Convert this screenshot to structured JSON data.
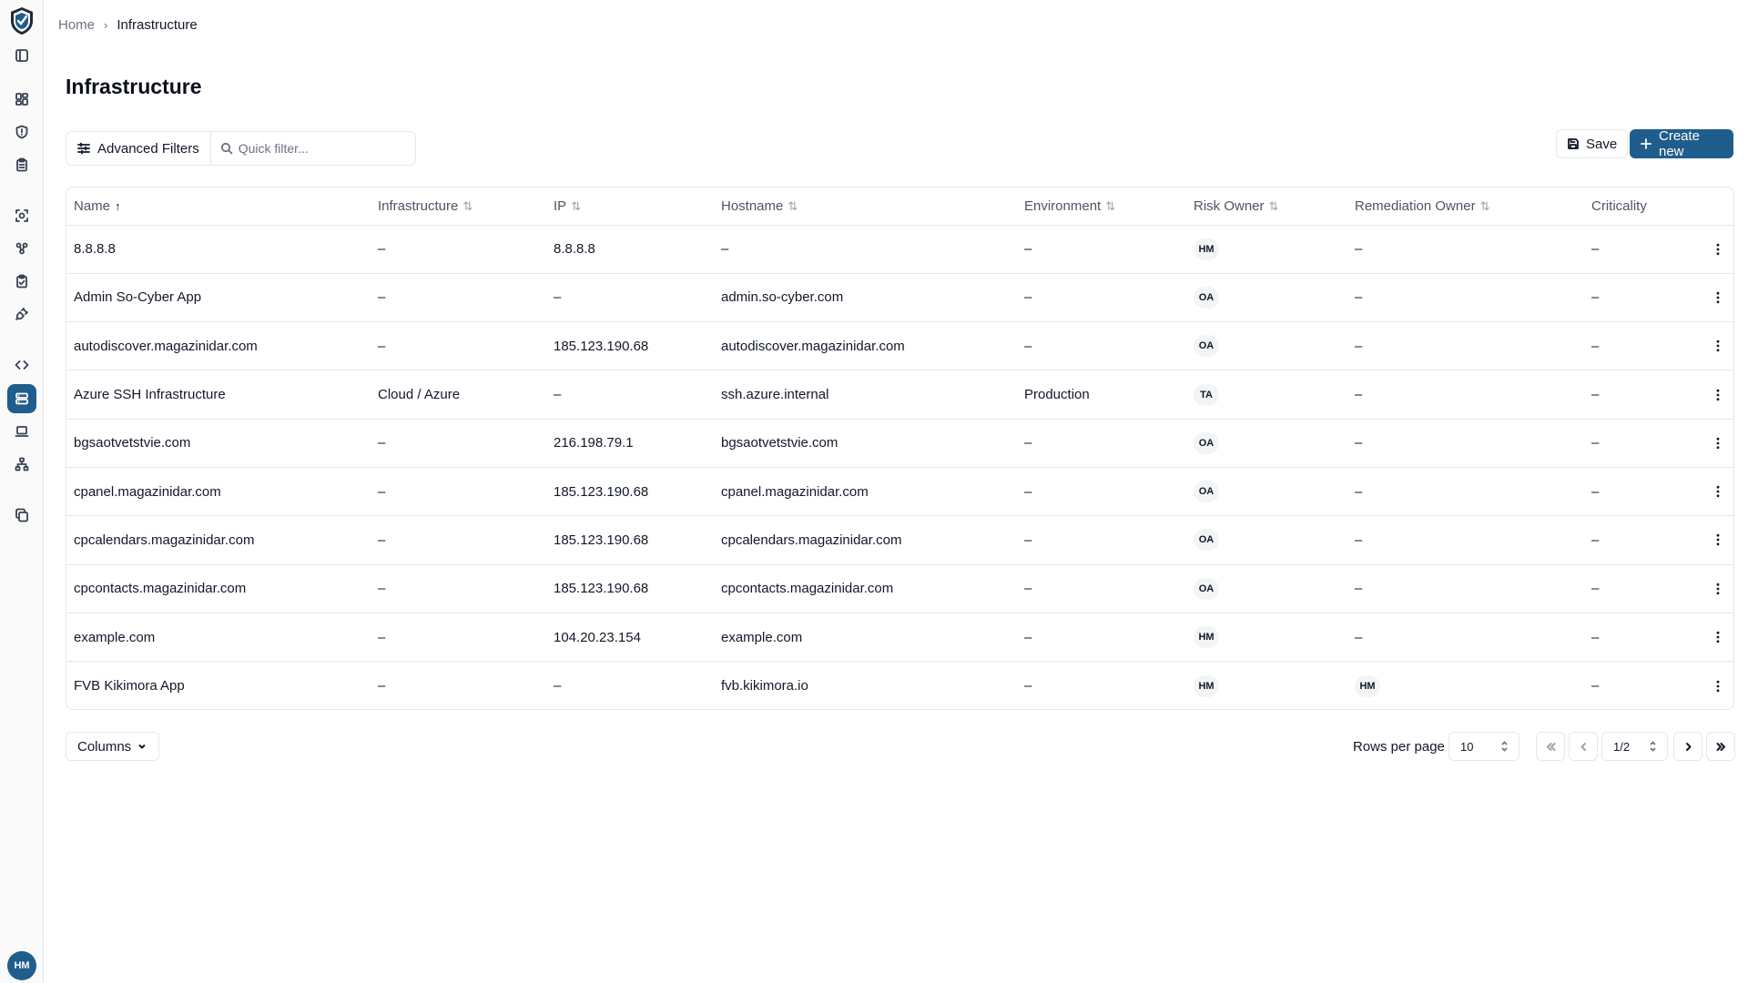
{
  "user": {
    "initials": "HM"
  },
  "colors": {
    "accent": "#1f5d8c",
    "border": "#e5e7eb",
    "muted": "#6b7280"
  },
  "breadcrumb": {
    "home": "Home",
    "current": "Infrastructure"
  },
  "page": {
    "title": "Infrastructure"
  },
  "toolbar": {
    "advanced_filters": "Advanced Filters",
    "quick_filter_placeholder": "Quick filter...",
    "save": "Save",
    "create_new": "Create new"
  },
  "table": {
    "headers": {
      "name": "Name",
      "infrastructure": "Infrastructure",
      "ip": "IP",
      "hostname": "Hostname",
      "environment": "Environment",
      "risk_owner": "Risk Owner",
      "remediation_owner": "Remediation Owner",
      "criticality": "Criticality"
    },
    "rows": [
      {
        "name": "8.8.8.8",
        "infrastructure": "–",
        "ip": "8.8.8.8",
        "hostname": "–",
        "environment": "–",
        "risk_owner": "HM",
        "remediation_owner": "–",
        "criticality": "–"
      },
      {
        "name": "Admin So-Cyber App",
        "infrastructure": "–",
        "ip": "–",
        "hostname": "admin.so-cyber.com",
        "environment": "–",
        "risk_owner": "OA",
        "remediation_owner": "–",
        "criticality": "–"
      },
      {
        "name": "autodiscover.magazinidar.com",
        "infrastructure": "–",
        "ip": "185.123.190.68",
        "hostname": "autodiscover.magazinidar.com",
        "environment": "–",
        "risk_owner": "OA",
        "remediation_owner": "–",
        "criticality": "–"
      },
      {
        "name": "Azure SSH Infrastructure",
        "infrastructure": "Cloud / Azure",
        "ip": "–",
        "hostname": "ssh.azure.internal",
        "environment": "Production",
        "risk_owner": "TA",
        "remediation_owner": "–",
        "criticality": "–"
      },
      {
        "name": "bgsaotvetstvie.com",
        "infrastructure": "–",
        "ip": "216.198.79.1",
        "hostname": "bgsaotvetstvie.com",
        "environment": "–",
        "risk_owner": "OA",
        "remediation_owner": "–",
        "criticality": "–"
      },
      {
        "name": "cpanel.magazinidar.com",
        "infrastructure": "–",
        "ip": "185.123.190.68",
        "hostname": "cpanel.magazinidar.com",
        "environment": "–",
        "risk_owner": "OA",
        "remediation_owner": "–",
        "criticality": "–"
      },
      {
        "name": "cpcalendars.magazinidar.com",
        "infrastructure": "–",
        "ip": "185.123.190.68",
        "hostname": "cpcalendars.magazinidar.com",
        "environment": "–",
        "risk_owner": "OA",
        "remediation_owner": "–",
        "criticality": "–"
      },
      {
        "name": "cpcontacts.magazinidar.com",
        "infrastructure": "–",
        "ip": "185.123.190.68",
        "hostname": "cpcontacts.magazinidar.com",
        "environment": "–",
        "risk_owner": "OA",
        "remediation_owner": "–",
        "criticality": "–"
      },
      {
        "name": "example.com",
        "infrastructure": "–",
        "ip": "104.20.23.154",
        "hostname": "example.com",
        "environment": "–",
        "risk_owner": "HM",
        "remediation_owner": "–",
        "criticality": "–"
      },
      {
        "name": "FVB Kikimora App",
        "infrastructure": "–",
        "ip": "–",
        "hostname": "fvb.kikimora.io",
        "environment": "–",
        "risk_owner": "HM",
        "remediation_owner": "HM",
        "criticality": "–"
      }
    ]
  },
  "footer": {
    "columns": "Columns",
    "rows_per_page_label": "Rows per page",
    "rows_per_page": "10",
    "page": "1/2"
  }
}
